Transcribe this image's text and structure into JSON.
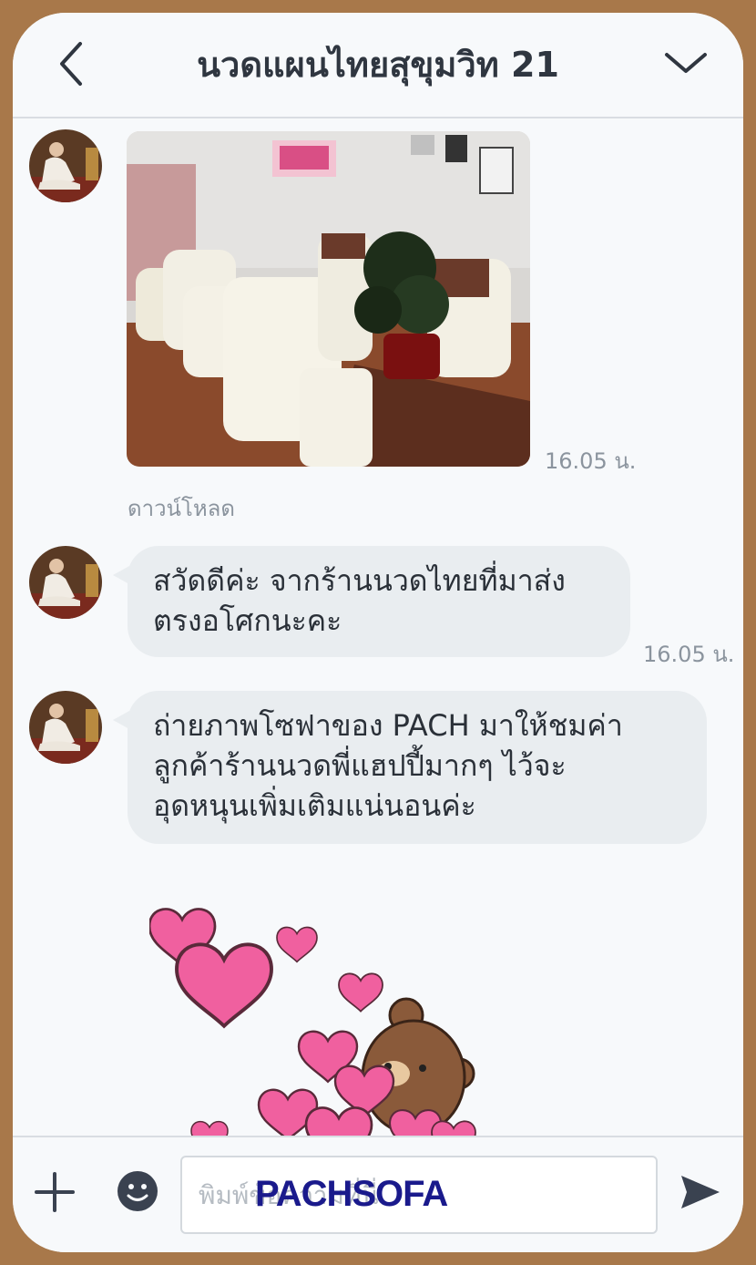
{
  "header": {
    "title": "นวดแผนไทยสุขุมวิท 21",
    "back_icon": "back-arrow-icon",
    "menu_icon": "chevron-down-icon"
  },
  "messages": {
    "image_time": "16.05 น.",
    "download_label": "ดาวน์โหลด",
    "msg1": {
      "lines": [
        "สวัดดีค่ะ จากร้านนวดไทยที่มาส่ง",
        "ตรงอโศกนะคะ"
      ],
      "time": "16.05 น."
    },
    "msg2": {
      "lines": [
        "ถ่ายภาพโซฟาของ PACH มาให้ชมค่า",
        "ลูกค้าร้านนวดพี่แฮปปี้มากๆ ไว้จะ",
        "อุดหนุนเพิ่มเติมแน่นอนค่ะ"
      ]
    }
  },
  "input": {
    "placeholder": "พิมพ์ข้อความที่นี่",
    "plus_icon": "plus-icon",
    "emoji_icon": "emoji-icon",
    "send_icon": "send-icon"
  },
  "watermark": "PACHSOFA",
  "colors": {
    "frame": "#a8784a",
    "bubble": "#e9edf0",
    "sticker_heart": "#f0609f",
    "bear": "#8a5a3a"
  }
}
